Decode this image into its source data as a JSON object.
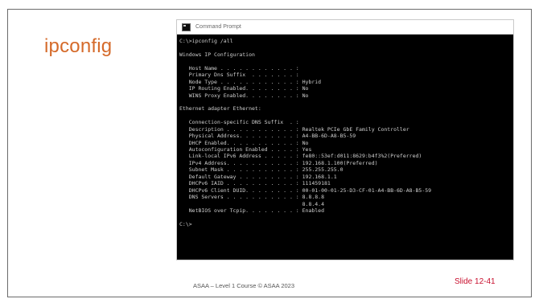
{
  "slide": {
    "title": "ipconfig",
    "footer_course": "ASAA – Level 1 Course © ASAA 2023",
    "slide_number": "Slide 12-41"
  },
  "console": {
    "window_title": "Command Prompt",
    "icon": "console-icon",
    "lines": [
      "C:\\>ipconfig /all",
      "",
      "Windows IP Configuration",
      "",
      "   Host Name . . . . . . . . . . . . :",
      "   Primary Dns Suffix  . . . . . . . :",
      "   Node Type . . . . . . . . . . . . : Hybrid",
      "   IP Routing Enabled. . . . . . . . : No",
      "   WINS Proxy Enabled. . . . . . . . : No",
      "",
      "Ethernet adapter Ethernet:",
      "",
      "   Connection-specific DNS Suffix  . :",
      "   Description . . . . . . . . . . . : Realtek PCIe GbE Family Controller",
      "   Physical Address. . . . . . . . . : A4-BB-6D-A8-B5-59",
      "   DHCP Enabled. . . . . . . . . . . : No",
      "   Autoconfiguration Enabled . . . . : Yes",
      "   Link-local IPv6 Address . . . . . : fe80::53ef:d011:8629:b4f3%2(Preferred)",
      "   IPv4 Address. . . . . . . . . . . : 192.168.1.100(Preferred)",
      "   Subnet Mask . . . . . . . . . . . : 255.255.255.0",
      "   Default Gateway . . . . . . . . . : 192.168.1.1",
      "   DHCPv6 IAID . . . . . . . . . . . : 111459181",
      "   DHCPv6 Client DUID. . . . . . . . : 00-01-00-01-25-D3-CF-01-A4-BB-6D-A8-B5-59",
      "   DNS Servers . . . . . . . . . . . : 8.8.8.8",
      "                                       8.8.4.4",
      "   NetBIOS over Tcpip. . . . . . . . : Enabled",
      "",
      "C:\\>"
    ]
  },
  "colors": {
    "title": "#d56a2a",
    "slide_number": "#c8102e",
    "console_bg": "#000000",
    "console_text": "#cfcfcf"
  }
}
